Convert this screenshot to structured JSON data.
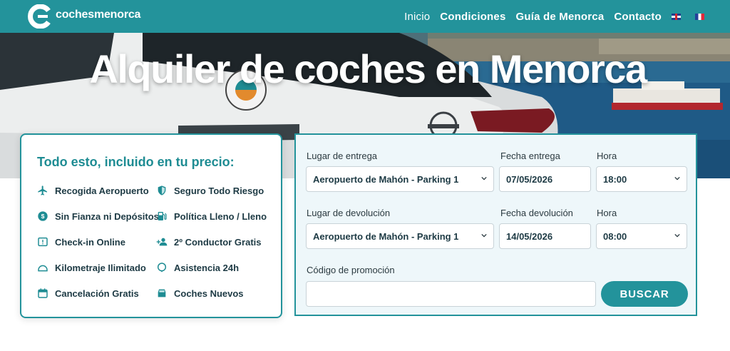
{
  "header": {
    "logo_text": "cochesmenorca",
    "nav": [
      {
        "label": "Inicio"
      },
      {
        "label": "Condiciones"
      },
      {
        "label": "Guía de Menorca"
      },
      {
        "label": "Contacto"
      }
    ]
  },
  "hero": {
    "title": "Alquiler de coches en Menorca"
  },
  "features": {
    "title": "Todo esto, incluido en tu precio:",
    "items": [
      {
        "label": "Recogida Aeropuerto",
        "icon": "airplane-icon"
      },
      {
        "label": "Seguro Todo Riesgo",
        "icon": "shield-icon"
      },
      {
        "label": "Sin Fianza ni Depósitos",
        "icon": "dollar-circle-icon"
      },
      {
        "label": "Política Lleno / Lleno",
        "icon": "fuel-pump-icon"
      },
      {
        "label": "Check-in Online",
        "icon": "alert-box-icon"
      },
      {
        "label": "2º Conductor Gratis",
        "icon": "add-person-icon"
      },
      {
        "label": "Kilometraje Ilimitado",
        "icon": "speedometer-icon"
      },
      {
        "label": "Asistencia 24h",
        "icon": "location-pin-icon"
      },
      {
        "label": "Cancelación Gratis",
        "icon": "calendar-icon"
      },
      {
        "label": "Coches Nuevos",
        "icon": "car-icon"
      }
    ]
  },
  "booking": {
    "pickup_location_label": "Lugar de entrega",
    "pickup_location_value": "Aeropuerto de Mahón - Parking 1",
    "pickup_date_label": "Fecha entrega",
    "pickup_date_value": "07/05/2026",
    "pickup_time_label": "Hora",
    "pickup_time_value": "18:00",
    "return_location_label": "Lugar de devolución",
    "return_location_value": "Aeropuerto de Mahón - Parking 1",
    "return_date_label": "Fecha devolución",
    "return_date_value": "14/05/2026",
    "return_time_label": "Hora",
    "return_time_value": "08:00",
    "promo_label": "Código de promoción",
    "promo_value": "",
    "search_label": "BUSCAR"
  },
  "colors": {
    "brand": "#23939b",
    "heading": "#1e8c93",
    "form_bg": "#eef7fa"
  }
}
